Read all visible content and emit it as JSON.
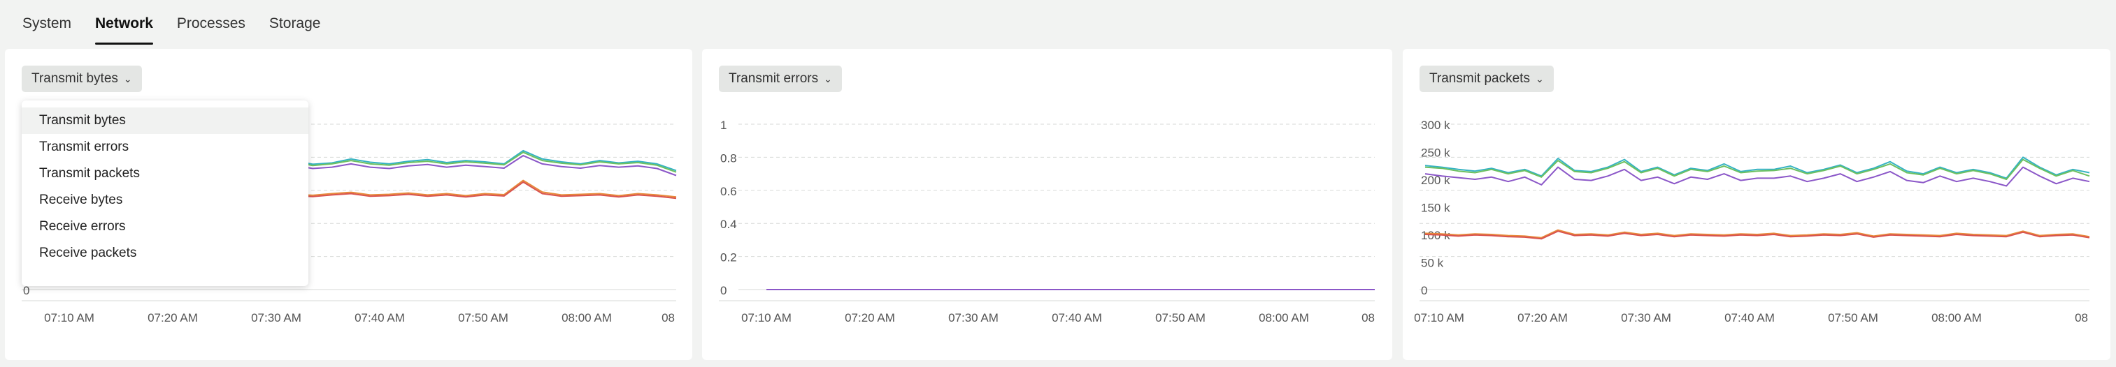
{
  "tabs": [
    {
      "label": "System",
      "active": false
    },
    {
      "label": "Network",
      "active": true
    },
    {
      "label": "Processes",
      "active": false
    },
    {
      "label": "Storage",
      "active": false
    }
  ],
  "colors": {
    "teal": "#36b3c2",
    "green": "#6cc060",
    "purple": "#8b57c8",
    "orange": "#e78a3a",
    "red": "#d9534f",
    "grid": "#d7d9d7"
  },
  "menu": {
    "selected": "Transmit bytes",
    "items": [
      "Transmit bytes",
      "Transmit errors",
      "Transmit packets",
      "Receive bytes",
      "Receive errors",
      "Receive packets"
    ]
  },
  "panels": [
    {
      "dropdown_label": "Transmit bytes",
      "dropdown_icon": "chevron-down-icon",
      "menu_open": true
    },
    {
      "dropdown_label": "Transmit errors",
      "dropdown_icon": "chevron-down-icon",
      "menu_open": false
    },
    {
      "dropdown_label": "Transmit packets",
      "dropdown_icon": "chevron-down-icon",
      "menu_open": false
    }
  ],
  "chart_data": [
    {
      "type": "line",
      "x_tick_labels": [
        "07:10 AM",
        "07:20 AM",
        "07:30 AM",
        "07:40 AM",
        "07:50 AM",
        "08:00 AM",
        "08"
      ],
      "y_tick_labels": [
        "0"
      ],
      "ylim": [
        0,
        5
      ],
      "grid": true,
      "series": [
        {
          "color": "teal",
          "values": [
            3.9,
            3.85,
            3.8,
            3.86,
            3.9,
            3.82,
            3.79,
            3.88,
            3.83,
            3.95,
            3.9,
            3.86,
            3.92,
            3.84,
            3.9,
            3.79,
            3.83,
            3.95,
            3.85,
            3.8,
            3.88,
            3.93,
            3.84,
            3.9,
            3.86,
            3.8,
            4.2,
            3.95,
            3.86,
            3.8,
            3.9,
            3.83,
            3.88,
            3.8,
            3.6
          ]
        },
        {
          "color": "green",
          "values": [
            3.85,
            3.8,
            3.75,
            3.82,
            3.86,
            3.78,
            3.75,
            3.84,
            3.79,
            3.9,
            3.85,
            3.82,
            3.88,
            3.8,
            3.86,
            3.75,
            3.8,
            3.9,
            3.8,
            3.76,
            3.84,
            3.88,
            3.8,
            3.86,
            3.82,
            3.77,
            4.15,
            3.9,
            3.82,
            3.77,
            3.86,
            3.8,
            3.84,
            3.76,
            3.55
          ]
        },
        {
          "color": "purple",
          "values": [
            3.75,
            3.7,
            3.66,
            3.72,
            3.76,
            3.68,
            3.65,
            3.74,
            3.69,
            3.8,
            3.75,
            3.72,
            3.77,
            3.7,
            3.76,
            3.66,
            3.7,
            3.8,
            3.7,
            3.66,
            3.74,
            3.78,
            3.7,
            3.76,
            3.72,
            3.67,
            4.05,
            3.8,
            3.72,
            3.67,
            3.75,
            3.7,
            3.74,
            3.66,
            3.45
          ]
        },
        {
          "color": "orange",
          "values": [
            2.9,
            2.85,
            2.88,
            2.9,
            2.86,
            2.92,
            2.84,
            2.9,
            2.88,
            2.95,
            2.87,
            2.9,
            2.86,
            2.92,
            2.88,
            2.85,
            2.9,
            2.94,
            2.86,
            2.88,
            2.92,
            2.86,
            2.9,
            2.84,
            2.9,
            2.87,
            3.3,
            2.95,
            2.86,
            2.88,
            2.9,
            2.84,
            2.9,
            2.86,
            2.8
          ]
        },
        {
          "color": "red",
          "values": [
            2.85,
            2.82,
            2.84,
            2.86,
            2.82,
            2.88,
            2.8,
            2.86,
            2.84,
            2.9,
            2.83,
            2.86,
            2.82,
            2.88,
            2.84,
            2.81,
            2.86,
            2.9,
            2.82,
            2.84,
            2.88,
            2.82,
            2.86,
            2.8,
            2.86,
            2.83,
            3.25,
            2.9,
            2.82,
            2.84,
            2.86,
            2.8,
            2.86,
            2.82,
            2.76
          ]
        }
      ]
    },
    {
      "type": "line",
      "x_tick_labels": [
        "07:10 AM",
        "07:20 AM",
        "07:30 AM",
        "07:40 AM",
        "07:50 AM",
        "08:00 AM",
        "08"
      ],
      "y_tick_labels": [
        "0",
        "0.2",
        "0.4",
        "0.6",
        "0.8",
        "1"
      ],
      "ylim": [
        0,
        1
      ],
      "grid": true,
      "series": [
        {
          "color": "purple",
          "values": [
            0,
            0,
            0,
            0,
            0,
            0,
            0,
            0,
            0,
            0
          ]
        }
      ]
    },
    {
      "type": "line",
      "x_tick_labels": [
        "07:10 AM",
        "07:20 AM",
        "07:30 AM",
        "07:40 AM",
        "07:50 AM",
        "08:00 AM",
        "08"
      ],
      "y_tick_labels": [
        "0",
        "50 k",
        "100 k",
        "150 k",
        "200 k",
        "250 k",
        "300 k"
      ],
      "ylim": [
        0,
        300000
      ],
      "grid": true,
      "series": [
        {
          "color": "teal",
          "values": [
            225000,
            222000,
            218000,
            215000,
            220000,
            212000,
            218000,
            206000,
            238000,
            216000,
            214000,
            222000,
            236000,
            214000,
            222000,
            208000,
            220000,
            216000,
            228000,
            214000,
            218000,
            218000,
            224000,
            212000,
            218000,
            226000,
            212000,
            220000,
            232000,
            215000,
            210000,
            222000,
            212000,
            218000,
            212000,
            202000,
            240000,
            222000,
            208000,
            218000,
            212000
          ]
        },
        {
          "color": "green",
          "values": [
            222000,
            220000,
            215000,
            212000,
            218000,
            210000,
            216000,
            204000,
            234000,
            214000,
            212000,
            220000,
            232000,
            212000,
            220000,
            206000,
            218000,
            214000,
            224000,
            212000,
            215000,
            216000,
            220000,
            210000,
            216000,
            224000,
            210000,
            218000,
            228000,
            212000,
            208000,
            220000,
            210000,
            216000,
            210000,
            200000,
            236000,
            220000,
            206000,
            216000,
            206000
          ]
        },
        {
          "color": "purple",
          "values": [
            210000,
            206000,
            203000,
            200000,
            204000,
            196000,
            204000,
            190000,
            222000,
            200000,
            198000,
            206000,
            218000,
            198000,
            204000,
            192000,
            204000,
            200000,
            210000,
            198000,
            202000,
            202000,
            206000,
            196000,
            202000,
            210000,
            196000,
            204000,
            214000,
            198000,
            194000,
            206000,
            196000,
            202000,
            196000,
            188000,
            222000,
            206000,
            192000,
            202000,
            196000
          ]
        },
        {
          "color": "orange",
          "values": [
            102000,
            101000,
            99000,
            101000,
            100000,
            98000,
            97000,
            94000,
            108000,
            100000,
            101000,
            99000,
            104000,
            100000,
            102000,
            98000,
            101000,
            100000,
            99000,
            101000,
            100000,
            102000,
            98000,
            99000,
            101000,
            100000,
            103000,
            97000,
            101000,
            100000,
            99000,
            98000,
            102000,
            100000,
            99000,
            98000,
            106000,
            98000,
            100000,
            101000,
            96000
          ]
        },
        {
          "color": "red",
          "values": [
            100000,
            99000,
            97000,
            99000,
            98000,
            96000,
            95000,
            92000,
            106000,
            98000,
            99000,
            97000,
            102000,
            98000,
            100000,
            96000,
            99000,
            98000,
            97000,
            99000,
            98000,
            100000,
            96000,
            97000,
            99000,
            98000,
            101000,
            95000,
            99000,
            98000,
            97000,
            96000,
            100000,
            98000,
            97000,
            96000,
            104000,
            96000,
            98000,
            99000,
            94000
          ]
        }
      ]
    }
  ]
}
